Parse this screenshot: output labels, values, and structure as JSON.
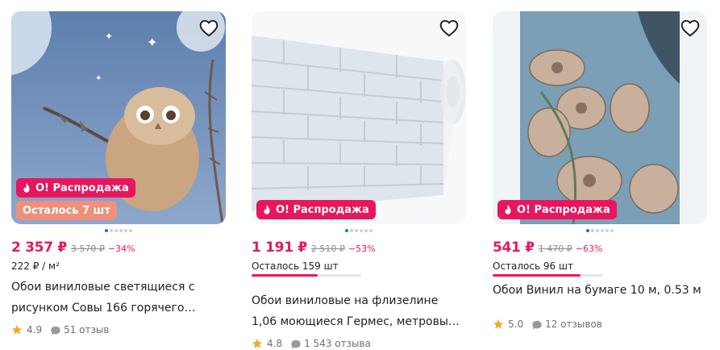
{
  "colors": {
    "accent": "#e8175d",
    "stock_badge": "#f0907a",
    "star": "#f5a623",
    "dot_active": "#1c6ed6"
  },
  "cards": [
    {
      "sale_badge": "О! Распродажа",
      "stock_badge": "Осталось 7 шт",
      "price": "2 357 ₽",
      "old_price": "3 570 ₽",
      "discount": "−34%",
      "unit_price": "222 ₽ / м²",
      "title_line1": "Обои виниловые светящиеся с",
      "title_line2": "рисунком Совы 166 горячего…",
      "rating": "4.9",
      "reviews": "51 отзыв",
      "icons": [
        "heart-icon",
        "fire-icon",
        "star-icon",
        "comment-icon"
      ]
    },
    {
      "sale_badge": "О! Распродажа",
      "price": "1 191 ₽",
      "old_price": "2 510 ₽",
      "discount": "−53%",
      "stock_text": "Осталось 159 шт",
      "stock_level": 0.6,
      "title_line1": "Обои виниловые на флизелине",
      "title_line2": "1,06 моющиеся Гермес, метровые…",
      "rating": "4.8",
      "reviews": "1 543 отзыва",
      "icons": [
        "heart-icon",
        "fire-icon",
        "star-icon",
        "comment-icon"
      ]
    },
    {
      "sale_badge": "О! Распродажа",
      "price": "541 ₽",
      "old_price": "1 470 ₽",
      "discount": "−63%",
      "stock_text": "Осталось 96 шт",
      "stock_level": 0.8,
      "title_line1": "Обои Винил на бумаге 10 м, 0.53 м",
      "rating": "5.0",
      "reviews": "12 отзывов",
      "icons": [
        "heart-icon",
        "fire-icon",
        "star-icon",
        "comment-icon"
      ]
    }
  ]
}
